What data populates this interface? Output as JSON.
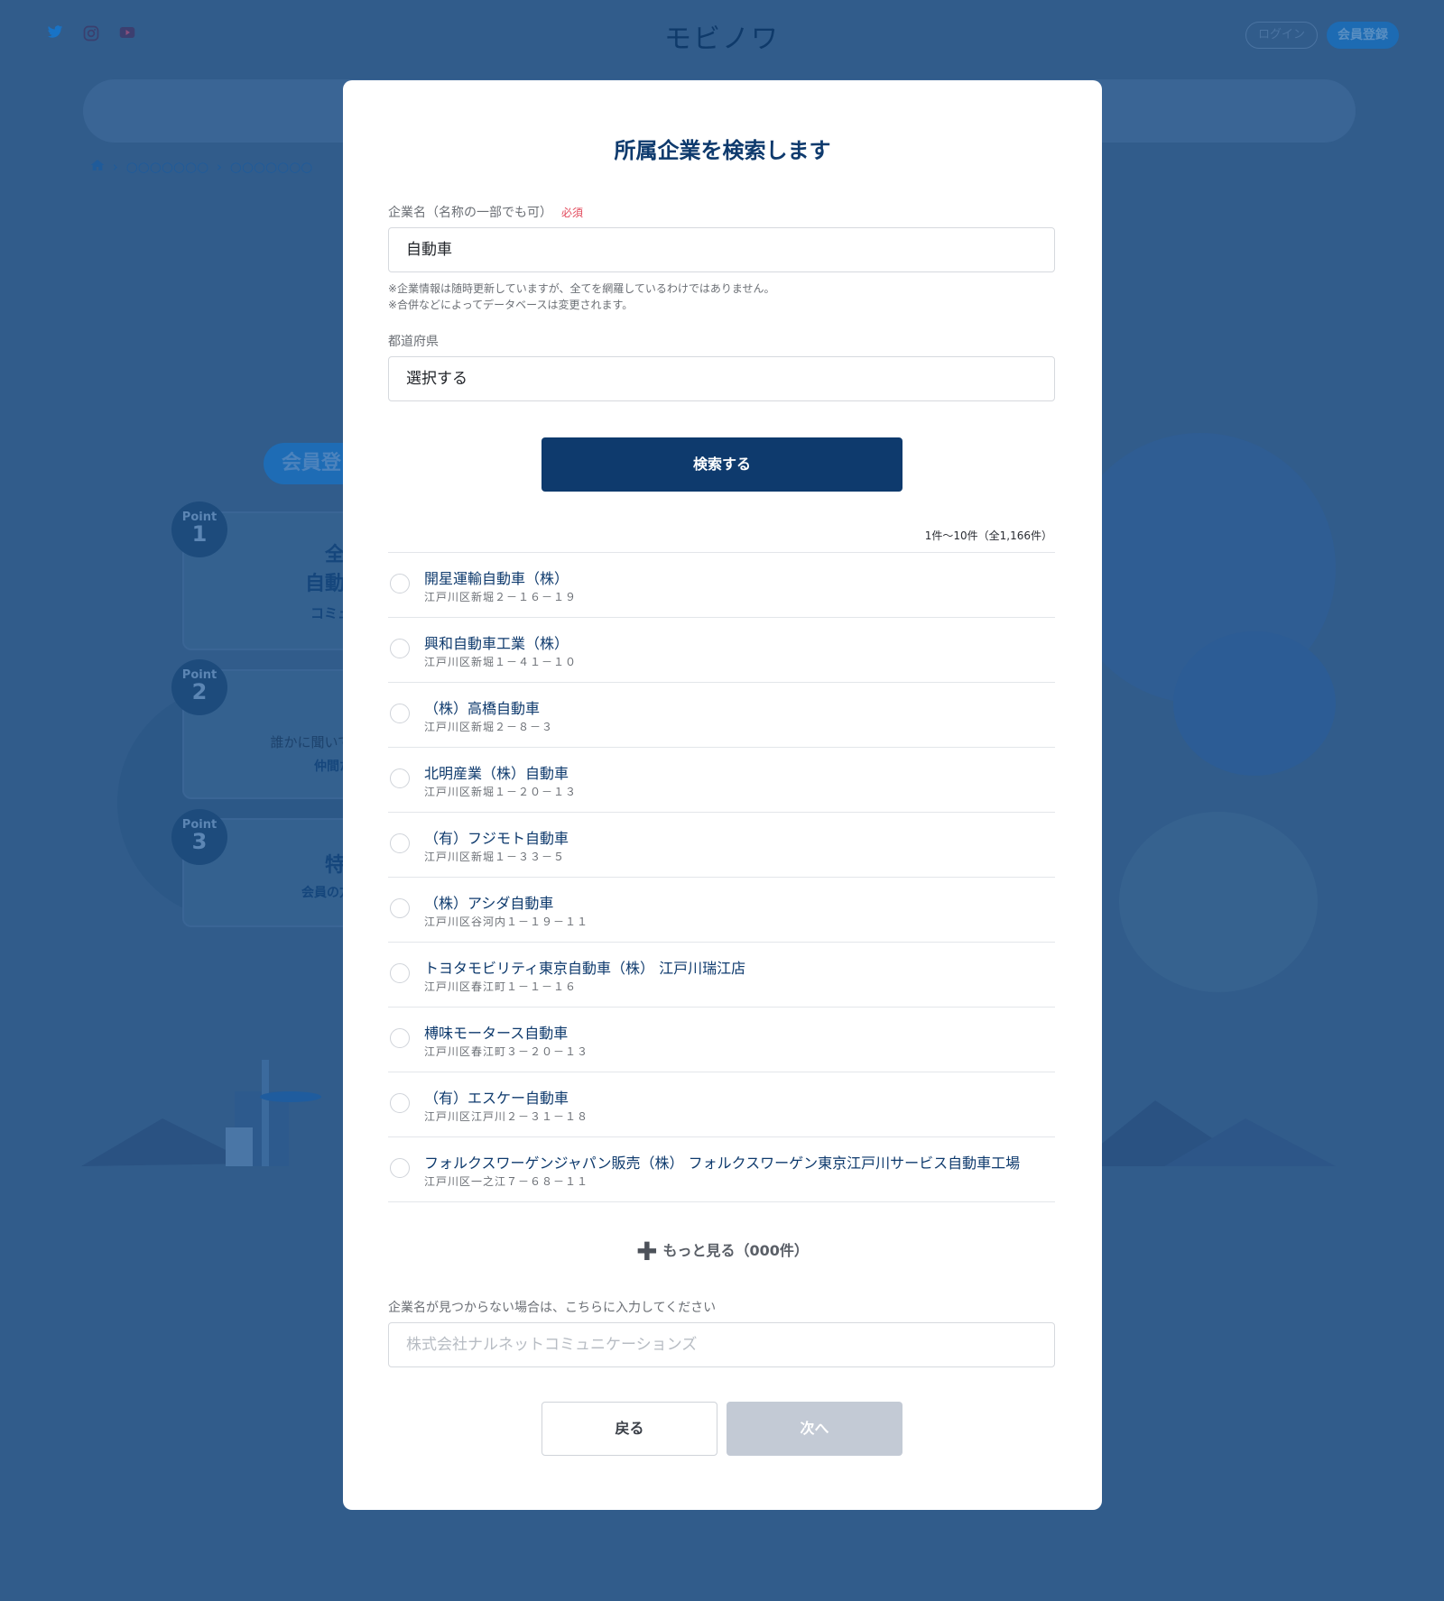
{
  "background": {
    "logo": "モビノワ",
    "login_label": "ログイン",
    "register_label": "会員登録",
    "breadcrumb": [
      "○○○○○○○",
      "○○○○○○○"
    ],
    "social": [
      "twitter-icon",
      "instagram-icon",
      "youtube-icon"
    ],
    "member_pill": "会員登",
    "points": [
      {
        "label": "Point",
        "num": "1",
        "title_lines": [
          "全国",
          "自動車"
        ],
        "sub": "コミュニ"
      },
      {
        "label": "Point",
        "num": "2",
        "title_lines": [
          "誰かに聞いてほ"
        ],
        "sub": "仲間たち"
      },
      {
        "label": "Point",
        "num": "3",
        "title_lines": [
          "特典"
        ],
        "sub": "会員の方限"
      }
    ]
  },
  "modal": {
    "title": "所属企業を検索します",
    "company_label": "企業名（名称の一部でも可）",
    "required_label": "必須",
    "company_value": "自動車",
    "notes": [
      "※企業情報は随時更新していますが、全てを網羅しているわけではありません。",
      "※合併などによってデータベースは変更されます。"
    ],
    "prefecture_label": "都道府県",
    "prefecture_value": "選択する",
    "search_button": "検索する",
    "result_count": "1件〜10件（全1,166件）",
    "results": [
      {
        "name": "開星運輸自動車（株）",
        "address": "江戸川区新堀２－１６－１９"
      },
      {
        "name": "興和自動車工業（株）",
        "address": "江戸川区新堀１－４１－１０"
      },
      {
        "name": "（株）高橋自動車",
        "address": "江戸川区新堀２－８－３"
      },
      {
        "name": "北明産業（株）自動車",
        "address": "江戸川区新堀１－２０－１３"
      },
      {
        "name": "（有）フジモト自動車",
        "address": "江戸川区新堀１－３３－５"
      },
      {
        "name": "（株）アシダ自動車",
        "address": "江戸川区谷河内１－１９－１１"
      },
      {
        "name": "トヨタモビリティ東京自動車（株） 江戸川瑞江店",
        "address": "江戸川区春江町１－１－１６"
      },
      {
        "name": "榑味モータース自動車",
        "address": "江戸川区春江町３－２０－１３"
      },
      {
        "name": "（有）エスケー自動車",
        "address": "江戸川区江戸川２－３１－１８"
      },
      {
        "name": "フォルクスワーゲンジャパン販売（株） フォルクスワーゲン東京江戸川サービス自動車工場",
        "address": "江戸川区一之江７－６８－１１"
      }
    ],
    "more_label": "もっと見る（000件）",
    "manual_label": "企業名が見つからない場合は、こちらに入力してください",
    "manual_placeholder": "株式会社ナルネットコミュニケーションズ",
    "back_button": "戻る",
    "next_button": "次へ"
  }
}
